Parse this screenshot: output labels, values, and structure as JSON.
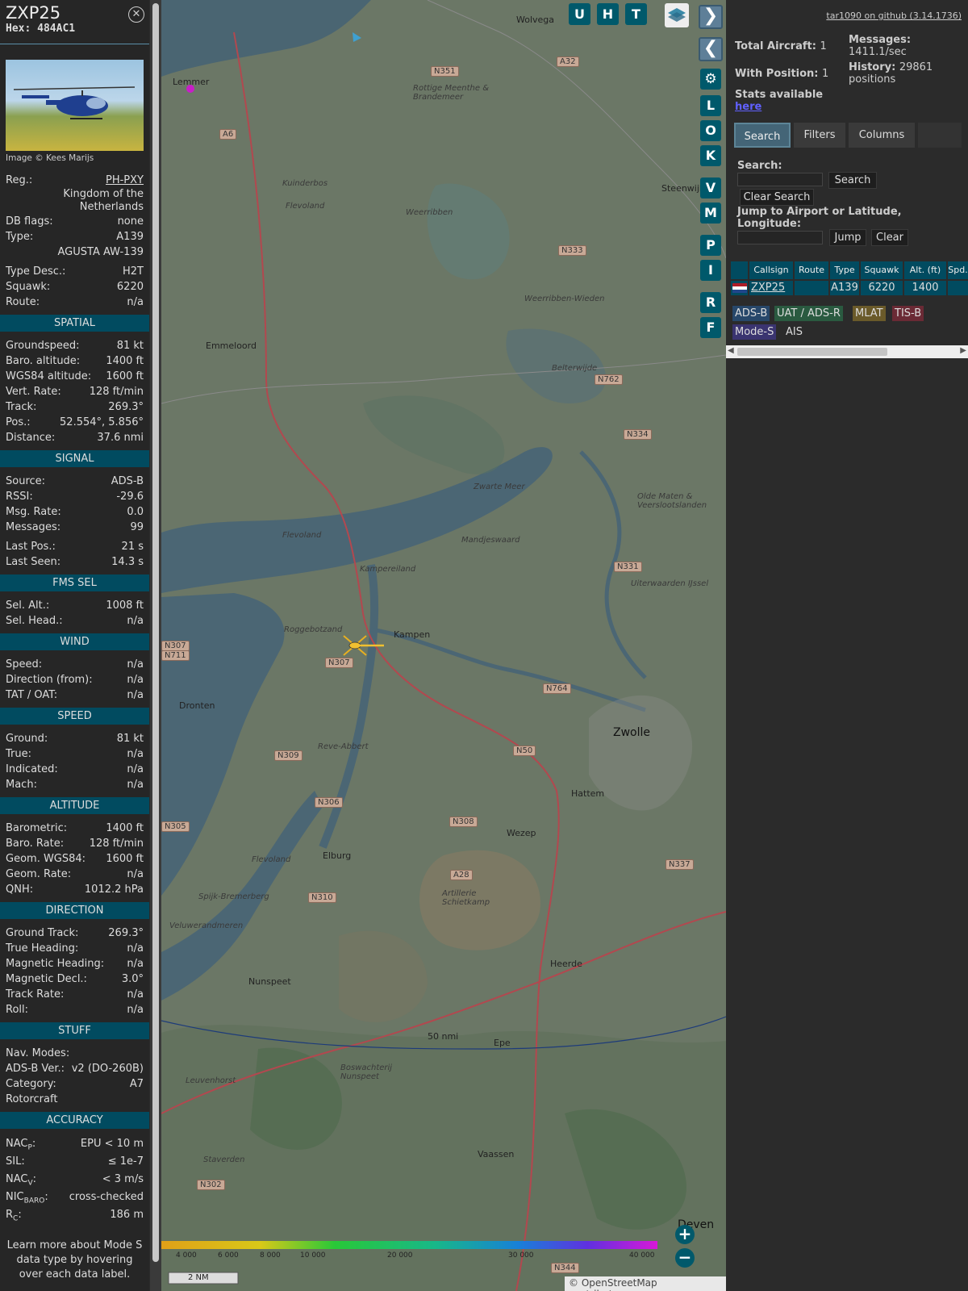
{
  "sidebar": {
    "callsign": "ZXP25",
    "hex": "Hex: 484AC1",
    "close_icon": "close-icon",
    "photo_credit": "Image © Kees Marijs",
    "info": {
      "reg_label": "Reg.:",
      "reg_value": "PH-PXY",
      "country": "Kingdom of the Netherlands",
      "dbflags_label": "DB flags:",
      "dbflags_value": "none",
      "type_label": "Type:",
      "type_value": "A139",
      "model": "AGUSTA AW-139",
      "typedesc_label": "Type Desc.:",
      "typedesc_value": "H2T",
      "squawk_label": "Squawk:",
      "squawk_value": "6220",
      "route_label": "Route:",
      "route_value": "n/a"
    },
    "spatial": {
      "title": "SPATIAL",
      "rows": [
        {
          "k": "Groundspeed:",
          "v": "81 kt"
        },
        {
          "k": "Baro. altitude:",
          "v": "1400 ft"
        },
        {
          "k": "WGS84 altitude:",
          "v": "1600 ft"
        },
        {
          "k": "Vert. Rate:",
          "v": "128 ft/min"
        },
        {
          "k": "Track:",
          "v": "269.3°"
        },
        {
          "k": "Pos.:",
          "v": "52.554°, 5.856°"
        },
        {
          "k": "Distance:",
          "v": "37.6 nmi"
        }
      ]
    },
    "signal": {
      "title": "SIGNAL",
      "rows": [
        {
          "k": "Source:",
          "v": "ADS-B"
        },
        {
          "k": "RSSI:",
          "v": "-29.6"
        },
        {
          "k": "Msg. Rate:",
          "v": "0.0"
        },
        {
          "k": "Messages:",
          "v": "99"
        }
      ],
      "rows2": [
        {
          "k": "Last Pos.:",
          "v": "21 s"
        },
        {
          "k": "Last Seen:",
          "v": "14.3 s"
        }
      ]
    },
    "fms": {
      "title": "FMS SEL",
      "rows": [
        {
          "k": "Sel. Alt.:",
          "v": "1008 ft"
        },
        {
          "k": "Sel. Head.:",
          "v": "n/a"
        }
      ]
    },
    "wind": {
      "title": "WIND",
      "rows": [
        {
          "k": "Speed:",
          "v": "n/a"
        },
        {
          "k": "Direction (from):",
          "v": "n/a"
        },
        {
          "k": "TAT / OAT:",
          "v": "n/a"
        }
      ]
    },
    "speed": {
      "title": "SPEED",
      "rows": [
        {
          "k": "Ground:",
          "v": "81 kt"
        },
        {
          "k": "True:",
          "v": "n/a"
        },
        {
          "k": "Indicated:",
          "v": "n/a"
        },
        {
          "k": "Mach:",
          "v": "n/a"
        }
      ]
    },
    "altitude": {
      "title": "ALTITUDE",
      "rows": [
        {
          "k": "Barometric:",
          "v": "1400 ft"
        },
        {
          "k": "Baro. Rate:",
          "v": "128 ft/min"
        },
        {
          "k": "Geom. WGS84:",
          "v": "1600 ft"
        },
        {
          "k": "Geom. Rate:",
          "v": "n/a"
        },
        {
          "k": "QNH:",
          "v": "1012.2 hPa"
        }
      ]
    },
    "direction": {
      "title": "DIRECTION",
      "rows": [
        {
          "k": "Ground Track:",
          "v": "269.3°"
        },
        {
          "k": "True Heading:",
          "v": "n/a"
        },
        {
          "k": "Magnetic Heading:",
          "v": "n/a"
        },
        {
          "k": "Magnetic Decl.:",
          "v": "3.0°"
        },
        {
          "k": "Track Rate:",
          "v": "n/a"
        },
        {
          "k": "Roll:",
          "v": "n/a"
        }
      ]
    },
    "stuff": {
      "title": "STUFF",
      "rows": [
        {
          "k": "Nav. Modes:",
          "v": ""
        },
        {
          "k": "ADS-B Ver.:",
          "v": "v2 (DO-260B)"
        },
        {
          "k": "Category:",
          "v": "A7"
        },
        {
          "k": "Rotorcraft",
          "v": ""
        }
      ]
    },
    "accuracy": {
      "title": "ACCURACY",
      "nacp_k": "NAC",
      "nacp_sub": "P",
      "nacp_v": "EPU < 10 m",
      "sil_k": "SIL:",
      "sil_v": "≤ 1e-7",
      "nacv_k": "NAC",
      "nacv_sub": "V",
      "nacv_v": "< 3 m/s",
      "nicbaro_k": "NIC",
      "nicbaro_sub": "BARO",
      "nicbaro_v": "cross-checked",
      "rc_k": "R",
      "rc_sub": "C",
      "rc_v": "186 m"
    },
    "note": "Learn more about Mode S data type by hovering over each data label."
  },
  "map": {
    "top_buttons": [
      "U",
      "H",
      "T"
    ],
    "layers_icon": "layers-icon",
    "side_buttons": [
      "L",
      "O",
      "K",
      "V",
      "M",
      "P",
      "I",
      "R",
      "F"
    ],
    "settings_icon": "gear-icon",
    "expand_icon": "chevron-right-icon",
    "collapse_icon": "chevron-left-icon",
    "toggle_icon": "arrows-left-right-icon",
    "places": [
      {
        "name": "Wolvega",
        "cls": ""
      },
      {
        "name": "Lemmer",
        "cls": ""
      },
      {
        "name": "Steenwijk",
        "cls": ""
      },
      {
        "name": "Emmeloord",
        "cls": ""
      },
      {
        "name": "Kampen",
        "cls": ""
      },
      {
        "name": "Dronten",
        "cls": ""
      },
      {
        "name": "Zwolle",
        "cls": "big"
      },
      {
        "name": "Hattem",
        "cls": ""
      },
      {
        "name": "Wezep",
        "cls": ""
      },
      {
        "name": "Elburg",
        "cls": ""
      },
      {
        "name": "Heerde",
        "cls": ""
      },
      {
        "name": "Nunspeet",
        "cls": ""
      },
      {
        "name": "Epe",
        "cls": ""
      },
      {
        "name": "Vaassen",
        "cls": ""
      },
      {
        "name": "Deven",
        "cls": "big"
      },
      {
        "name": "Weerribben",
        "cls": "it"
      },
      {
        "name": "Kampereiland",
        "cls": "it"
      },
      {
        "name": "Mandjeswaard",
        "cls": "it"
      },
      {
        "name": "Artillerie Schietkamp",
        "cls": "it"
      },
      {
        "name": "Veluwerandmeren",
        "cls": "it"
      },
      {
        "name": "Spijk-Bremerberg",
        "cls": "it"
      },
      {
        "name": "Kuinderbos",
        "cls": "it"
      },
      {
        "name": "Roggebotzand",
        "cls": "it"
      },
      {
        "name": "Reve-Abbert",
        "cls": "it"
      },
      {
        "name": "Leuvenhorst",
        "cls": "it"
      },
      {
        "name": "Staverden",
        "cls": "it"
      },
      {
        "name": "Zwarte Meer",
        "cls": "it"
      },
      {
        "name": "Uiterwaarden IJssel",
        "cls": "it"
      },
      {
        "name": "Weerribben-Wieden",
        "cls": "it"
      },
      {
        "name": "Boswachterij Nunspeet",
        "cls": "it"
      },
      {
        "name": "Rottige Meenthe & Brandemeer",
        "cls": "it"
      },
      {
        "name": "Olde Maten & Veerslootslanden",
        "cls": "it"
      },
      {
        "name": "Belterwijde",
        "cls": "it"
      },
      {
        "name": "Flevoland",
        "cls": "it"
      },
      {
        "name": "Flevoland",
        "cls": "it"
      },
      {
        "name": "Flevoland",
        "cls": "it"
      }
    ],
    "roads": [
      "N351",
      "A32",
      "A6",
      "N333",
      "N762",
      "N334",
      "N331",
      "N307",
      "N711",
      "N307",
      "N764",
      "N309",
      "N50",
      "N306",
      "N308",
      "N337",
      "A28",
      "N310",
      "N305",
      "N302",
      "N344"
    ],
    "range_label": "50 nmi",
    "scale_label": "2 NM",
    "attribution": "© OpenStreetMap contributors.",
    "zoom_in": "+",
    "zoom_out": "−",
    "alt_ticks": [
      "4 000",
      "6 000",
      "8 000",
      "10 000",
      "20 000",
      "30 000",
      "40 000"
    ]
  },
  "panel": {
    "github": "tar1090 on github (3.14.1736)",
    "total_label": "Total Aircraft:",
    "total_value": "1",
    "withpos_label": "With Position:",
    "withpos_value": "1",
    "stats_label": "Stats available",
    "stats_link": "here",
    "messages_label": "Messages:",
    "messages_value": "1411.1/sec",
    "history_label": "History:",
    "history_value": "29861 positions",
    "tabs": [
      "Search",
      "Filters",
      "Columns"
    ],
    "search_label": "Search:",
    "search_button": "Search",
    "clear_search_button": "Clear Search",
    "jump_label": "Jump to Airport or Latitude, Longitude:",
    "jump_button": "Jump",
    "clear_button": "Clear",
    "table": {
      "headers": [
        "",
        "Callsign",
        "Route",
        "Type",
        "Squawk",
        "Alt. (ft)",
        "Spd."
      ],
      "row": {
        "callsign": "ZXP25",
        "route": "",
        "type": "A139",
        "squawk": "6220",
        "alt": "1400"
      }
    },
    "legend": [
      {
        "label": "ADS-B",
        "bg": "#27476a"
      },
      {
        "label": "UAT / ADS-R",
        "bg": "#2a5a40"
      },
      {
        "label": "MLAT",
        "bg": "#6a5a2a"
      },
      {
        "label": "TIS-B",
        "bg": "#6a2a35"
      },
      {
        "label": "Mode-S",
        "bg": "#3a3470"
      },
      {
        "label": "AIS",
        "bg": "transparent"
      }
    ]
  }
}
